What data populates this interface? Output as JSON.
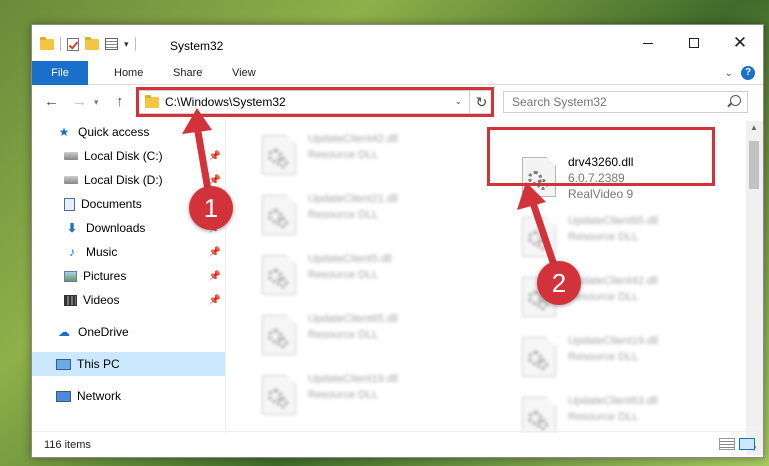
{
  "window": {
    "title": "System32",
    "controls": {
      "minimize": "",
      "maximize": "",
      "close": "✕"
    }
  },
  "ribbon": {
    "tabs": [
      "File",
      "Home",
      "Share",
      "View"
    ]
  },
  "navigation": {
    "address": "C:\\Windows\\System32",
    "search_placeholder": "Search System32"
  },
  "sidebar": {
    "items": [
      {
        "label": "Quick access",
        "icon": "star-icon",
        "pinned": false
      },
      {
        "label": "Local Disk (C:)",
        "icon": "drive-icon",
        "pinned": true
      },
      {
        "label": "Local Disk (D:)",
        "icon": "drive-icon",
        "pinned": true
      },
      {
        "label": "Documents",
        "icon": "documents-icon",
        "pinned": true
      },
      {
        "label": "Downloads",
        "icon": "download-icon",
        "pinned": true
      },
      {
        "label": "Music",
        "icon": "music-icon",
        "pinned": true
      },
      {
        "label": "Pictures",
        "icon": "pictures-icon",
        "pinned": true
      },
      {
        "label": "Videos",
        "icon": "videos-icon",
        "pinned": true
      },
      {
        "label": "OneDrive",
        "icon": "cloud-icon",
        "pinned": false
      },
      {
        "label": "This PC",
        "icon": "computer-icon",
        "pinned": false,
        "selected": true
      },
      {
        "label": "Network",
        "icon": "network-icon",
        "pinned": false
      }
    ]
  },
  "files": {
    "highlighted": {
      "name": "drv43260.dll",
      "version": "6.0.7.2389",
      "product": "RealVideo 9"
    },
    "blurred": [
      {
        "name": "UpdateClient42.dll",
        "type": "Resource DLL"
      },
      {
        "name": "UpdateClient21.dll",
        "type": "Resource DLL"
      },
      {
        "name": "UpdateClient65.dll",
        "type": "Resource DLL"
      },
      {
        "name": "UpdateClient5.dll",
        "type": "Resource DLL"
      },
      {
        "name": "UpdateClient42.dll",
        "type": "Resource DLL"
      },
      {
        "name": "UpdateClient65.dll",
        "type": "Resource DLL"
      },
      {
        "name": "UpdateClient19.dll",
        "type": "Resource DLL"
      },
      {
        "name": "UpdateClient19.dll",
        "type": "Resource DLL"
      },
      {
        "name": "UpdateClient63.dll",
        "type": "Resource DLL"
      }
    ]
  },
  "status": {
    "item_count": "116 items"
  },
  "annotations": {
    "step1": "1",
    "step2": "2",
    "color": "#d2323a"
  }
}
